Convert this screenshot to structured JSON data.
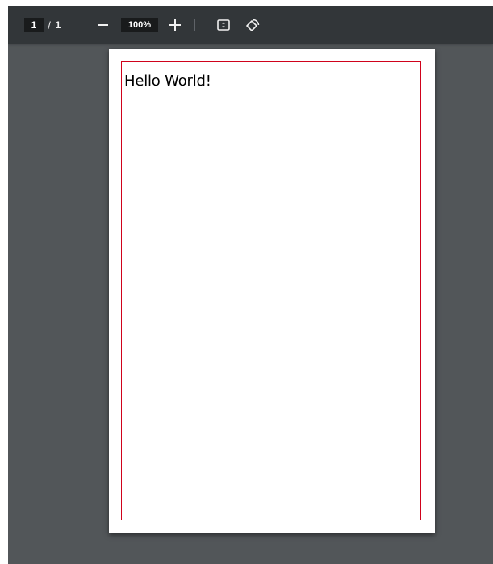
{
  "toolbar": {
    "current_page": "1",
    "page_separator": "/",
    "total_pages": "1",
    "zoom_level": "100%",
    "icons": {
      "zoom_out": "minus-icon",
      "zoom_in": "plus-icon",
      "fit": "fit-to-page-icon",
      "rotate": "rotate-icon"
    }
  },
  "document": {
    "text": "Hello World!",
    "border_color": "#d0021b"
  },
  "colors": {
    "toolbar_bg": "#323639",
    "viewer_bg": "#525659",
    "field_bg": "#191b1c"
  }
}
